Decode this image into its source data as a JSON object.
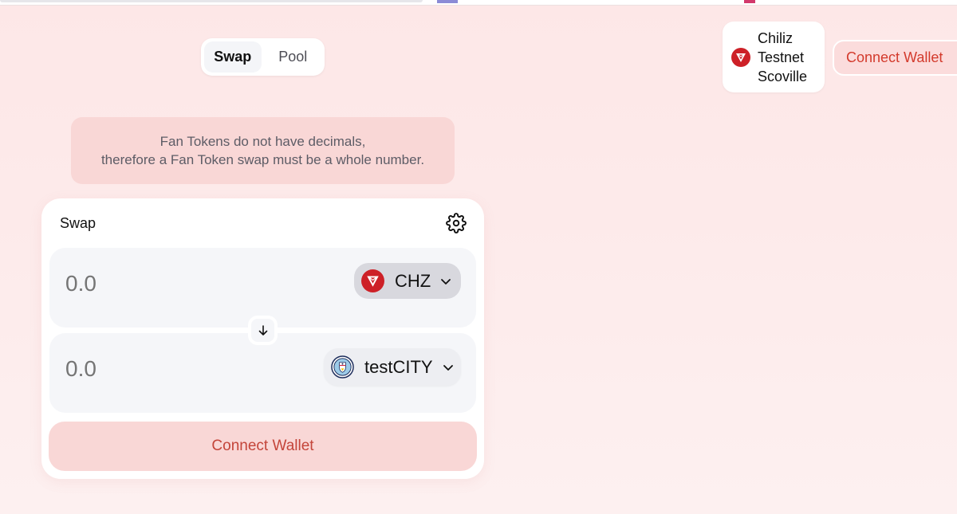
{
  "nav": {
    "tabs": [
      {
        "label": "Swap",
        "active": true
      },
      {
        "label": "Pool",
        "active": false
      }
    ]
  },
  "network": {
    "lines": [
      "Chiliz",
      "Testnet",
      "Scoville"
    ],
    "icon": "chiliz-logo-icon"
  },
  "header": {
    "connect_label": "Connect Wallet"
  },
  "notice": {
    "line1": "Fan Tokens do not have decimals,",
    "line2": "therefore a Fan Token swap must be a whole number."
  },
  "swap": {
    "title": "Swap",
    "settings_icon": "gear-icon",
    "input": {
      "placeholder": "0.0",
      "token": "CHZ",
      "icon": "chiliz-logo-icon"
    },
    "output": {
      "placeholder": "0.0",
      "token": "testCITY",
      "icon": "man-city-badge-icon"
    },
    "switch_icon": "arrow-down-icon",
    "connect_label": "Connect Wallet"
  },
  "colors": {
    "accent": "#d33a2c",
    "accent_bg": "#f9d7d6",
    "chz_red": "#cd2027"
  }
}
